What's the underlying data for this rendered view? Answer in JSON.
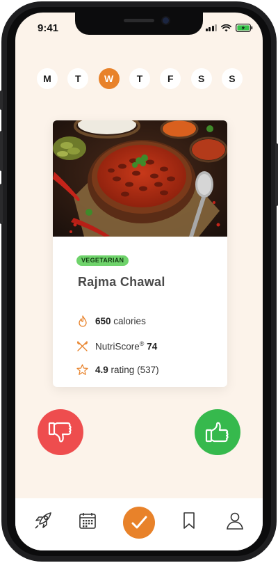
{
  "status": {
    "time": "9:41"
  },
  "days": [
    "M",
    "T",
    "W",
    "T",
    "F",
    "S",
    "S"
  ],
  "selected_day_index": 2,
  "recipe": {
    "image_alt": "Bowl of rajma curry with rice, pickles and chilies",
    "badge": "VEGETARIAN",
    "name": "Rajma Chawal",
    "calories_value": "650",
    "calories_unit": "calories",
    "nutri_label": "NutriScore",
    "nutri_symbol": "®",
    "nutri_value": "74",
    "rating_value": "4.9",
    "rating_label": "rating (537)"
  },
  "actions": {
    "dislike_icon": "thumbs-down-icon",
    "like_icon": "thumbs-up-icon"
  },
  "tabs": [
    {
      "name": "tab-discover",
      "icon": "rocket-icon"
    },
    {
      "name": "tab-calendar",
      "icon": "calendar-icon"
    },
    {
      "name": "tab-confirm",
      "icon": "check-icon"
    },
    {
      "name": "tab-saved",
      "icon": "bookmark-icon"
    },
    {
      "name": "tab-profile",
      "icon": "user-icon"
    }
  ],
  "colors": {
    "accent": "#e8822a",
    "background": "#fcf3ea",
    "like": "#36b94d",
    "dislike": "#ee4d4e",
    "badge": "#6fd36b"
  }
}
